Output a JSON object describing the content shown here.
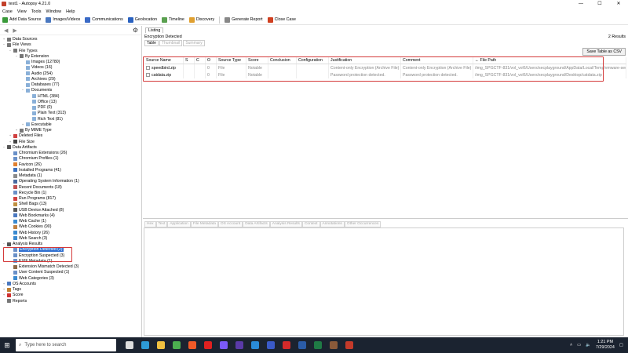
{
  "window": {
    "title": "test1 - Autopsy 4.21.0",
    "controls": [
      "—",
      "☐",
      "✕"
    ]
  },
  "menu": [
    "Case",
    "View",
    "Tools",
    "Window",
    "Help"
  ],
  "toolbar": [
    {
      "label": "Add Data Source",
      "icon": "add-data-source-icon",
      "color": "#3a9a3a"
    },
    {
      "label": "Images/Videos",
      "icon": "images-icon",
      "color": "#4a78c0"
    },
    {
      "label": "Communications",
      "icon": "communications-icon",
      "color": "#3a6ac6"
    },
    {
      "label": "Geolocation",
      "icon": "geolocation-icon",
      "color": "#2a62c0"
    },
    {
      "label": "Timeline",
      "icon": "timeline-icon",
      "color": "#5aa050"
    },
    {
      "label": "Discovery",
      "icon": "discovery-icon",
      "color": "#e0a030"
    },
    {
      "label": "Generate Report",
      "icon": "report-icon",
      "color": "#888888"
    },
    {
      "label": "Close Case",
      "icon": "close-case-icon",
      "color": "#d04020"
    }
  ],
  "tree": [
    {
      "label": "Data Sources",
      "level": 0,
      "toggle": "+",
      "color": "#777777"
    },
    {
      "label": "File Views",
      "level": 0,
      "toggle": "−",
      "color": "#777777"
    },
    {
      "label": "File Types",
      "level": 1,
      "toggle": "−",
      "color": "#777777"
    },
    {
      "label": "By Extension",
      "level": 2,
      "toggle": "−",
      "color": "#777777"
    },
    {
      "label": "Images (12780)",
      "level": 3,
      "toggle": "",
      "color": "#8ab0d8"
    },
    {
      "label": "Videos (16)",
      "level": 3,
      "toggle": "",
      "color": "#8ab0d8"
    },
    {
      "label": "Audio (254)",
      "level": 3,
      "toggle": "",
      "color": "#8ab0d8"
    },
    {
      "label": "Archives (29)",
      "level": 3,
      "toggle": "",
      "color": "#8ab0d8"
    },
    {
      "label": "Databases (77)",
      "level": 3,
      "toggle": "",
      "color": "#8ab0d8"
    },
    {
      "label": "Documents",
      "level": 3,
      "toggle": "−",
      "color": "#8ab0d8"
    },
    {
      "label": "HTML (384)",
      "level": 4,
      "toggle": "",
      "color": "#8ab0d8"
    },
    {
      "label": "Office (13)",
      "level": 4,
      "toggle": "",
      "color": "#8ab0d8"
    },
    {
      "label": "PDF (0)",
      "level": 4,
      "toggle": "",
      "color": "#8ab0d8"
    },
    {
      "label": "Plain Text (313)",
      "level": 4,
      "toggle": "",
      "color": "#8ab0d8"
    },
    {
      "label": "Rich Text (81)",
      "level": 4,
      "toggle": "",
      "color": "#8ab0d8"
    },
    {
      "label": "Executable",
      "level": 3,
      "toggle": "+",
      "color": "#8ab0d8"
    },
    {
      "label": "By MIME Type",
      "level": 2,
      "toggle": "+",
      "color": "#777777"
    },
    {
      "label": "Deleted Files",
      "level": 1,
      "toggle": "+",
      "color": "#d04040"
    },
    {
      "label": "File Size",
      "level": 1,
      "toggle": "+",
      "color": "#444444"
    },
    {
      "label": "Data Artifacts",
      "level": 0,
      "toggle": "−",
      "color": "#555555"
    },
    {
      "label": "Chromium Extensions (26)",
      "level": 1,
      "toggle": "",
      "color": "#6a90c8"
    },
    {
      "label": "Chromium Profiles (1)",
      "level": 1,
      "toggle": "",
      "color": "#6a90c8"
    },
    {
      "label": "Favicon (26)",
      "level": 1,
      "toggle": "",
      "color": "#e08030"
    },
    {
      "label": "Installed Programs (41)",
      "level": 1,
      "toggle": "",
      "color": "#3a70c0"
    },
    {
      "label": "Metadata (1)",
      "level": 1,
      "toggle": "",
      "color": "#8a8a8a"
    },
    {
      "label": "Operating System Information (1)",
      "level": 1,
      "toggle": "",
      "color": "#4a6aa0"
    },
    {
      "label": "Recent Documents (18)",
      "level": 1,
      "toggle": "",
      "color": "#c05050"
    },
    {
      "label": "Recycle Bin (1)",
      "level": 1,
      "toggle": "",
      "color": "#6a90c8"
    },
    {
      "label": "Run Programs (817)",
      "level": 1,
      "toggle": "",
      "color": "#d04040"
    },
    {
      "label": "Shell Bags (13)",
      "level": 1,
      "toggle": "",
      "color": "#c09040"
    },
    {
      "label": "USB Device Attached (8)",
      "level": 1,
      "toggle": "",
      "color": "#555555"
    },
    {
      "label": "Web Bookmarks (4)",
      "level": 1,
      "toggle": "",
      "color": "#4a78c0"
    },
    {
      "label": "Web Cache (1)",
      "level": 1,
      "toggle": "",
      "color": "#3a8ad0"
    },
    {
      "label": "Web Cookies (90)",
      "level": 1,
      "toggle": "",
      "color": "#c08040"
    },
    {
      "label": "Web History (26)",
      "level": 1,
      "toggle": "",
      "color": "#3a8ad0"
    },
    {
      "label": "Web Search (3)",
      "level": 1,
      "toggle": "",
      "color": "#3a8ad0"
    },
    {
      "label": "Analysis Results",
      "level": 0,
      "toggle": "−",
      "color": "#555555"
    },
    {
      "label": "Encryption Detected (2)",
      "level": 1,
      "toggle": "",
      "color": "#6a90c8",
      "selected": true
    },
    {
      "label": "Encryption Suspected (3)",
      "level": 1,
      "toggle": "",
      "color": "#6a90c8"
    },
    {
      "label": "EXIF Metadata (1)",
      "level": 1,
      "toggle": "",
      "color": "#6a90c8"
    },
    {
      "label": "Extension Mismatch Detected (3)",
      "level": 1,
      "toggle": "",
      "color": "#8a6a4a"
    },
    {
      "label": "User Content Suspected (1)",
      "level": 1,
      "toggle": "",
      "color": "#6a90c8"
    },
    {
      "label": "Web Categories (3)",
      "level": 1,
      "toggle": "",
      "color": "#3a8ad0"
    },
    {
      "label": "OS Accounts",
      "level": 0,
      "toggle": "+",
      "color": "#4a78c0"
    },
    {
      "label": "Tags",
      "level": 0,
      "toggle": "+",
      "color": "#c08030"
    },
    {
      "label": "Score",
      "level": 0,
      "toggle": "+",
      "color": "#d03030"
    },
    {
      "label": "Reports",
      "level": 0,
      "toggle": "",
      "color": "#777777"
    }
  ],
  "listing": {
    "tab": "Listing",
    "header": "Encryption Detected",
    "count": "2  Results",
    "subtabs": [
      "Table",
      "Thumbnail",
      "Summary"
    ],
    "save_label": "Save Table as CSV",
    "columns": [
      "Source Name",
      "S",
      "C",
      "O",
      "Source Type",
      "Score",
      "Conclusion",
      "Configuration",
      "Justification",
      "Comment",
      "← File Path"
    ],
    "rows": [
      [
        "speedbird.zip",
        "",
        "",
        "0",
        "File",
        "Notable",
        "",
        "",
        "Content-only Encryption (Archive File)",
        "Content-only Encryption (Archive File)",
        "/img_SPGCTF-831/vol_vol6/Users/secplayground/AppData/Local/Temp/vmware-secpla..."
      ],
      [
        "catdata.zip",
        "",
        "",
        "0",
        "File",
        "Notable",
        "",
        "",
        "Password protection detected.",
        "Password protection detected.",
        "/img_SPGCTF-831/vol_vol6/Users/secplayground/Desktop/catdata.zip"
      ]
    ]
  },
  "content_tabs": [
    "Hex",
    "Text",
    "Application",
    "File Metadata",
    "OS Account",
    "Data Artifacts",
    "Analysis Results",
    "Context",
    "Annotations",
    "Other Occurrences"
  ],
  "taskbar": {
    "search_placeholder": "Type here to search",
    "time": "1:21 PM",
    "date": "7/29/2024",
    "app_icons": [
      {
        "name": "task-view-icon",
        "color": "#dddddd"
      },
      {
        "name": "edge-icon",
        "color": "#2e9ad6"
      },
      {
        "name": "file-explorer-icon",
        "color": "#f0c040"
      },
      {
        "name": "chrome-icon",
        "color": "#4caf50"
      },
      {
        "name": "brave-icon",
        "color": "#f05a28"
      },
      {
        "name": "youtube-icon",
        "color": "#e02020"
      },
      {
        "name": "messenger-icon",
        "color": "#7a5af8"
      },
      {
        "name": "app-purple-icon",
        "color": "#5a3aa8"
      },
      {
        "name": "vscode-icon",
        "color": "#2a8ad8"
      },
      {
        "name": "app-blue-icon",
        "color": "#3a5ac8"
      },
      {
        "name": "acrobat-icon",
        "color": "#d42a2a"
      },
      {
        "name": "word-icon",
        "color": "#2b5ca8"
      },
      {
        "name": "excel-icon",
        "color": "#1f7a45"
      },
      {
        "name": "autopsy-icon",
        "color": "#8a5a3a"
      },
      {
        "name": "app-red-icon",
        "color": "#c43a2a"
      }
    ]
  }
}
